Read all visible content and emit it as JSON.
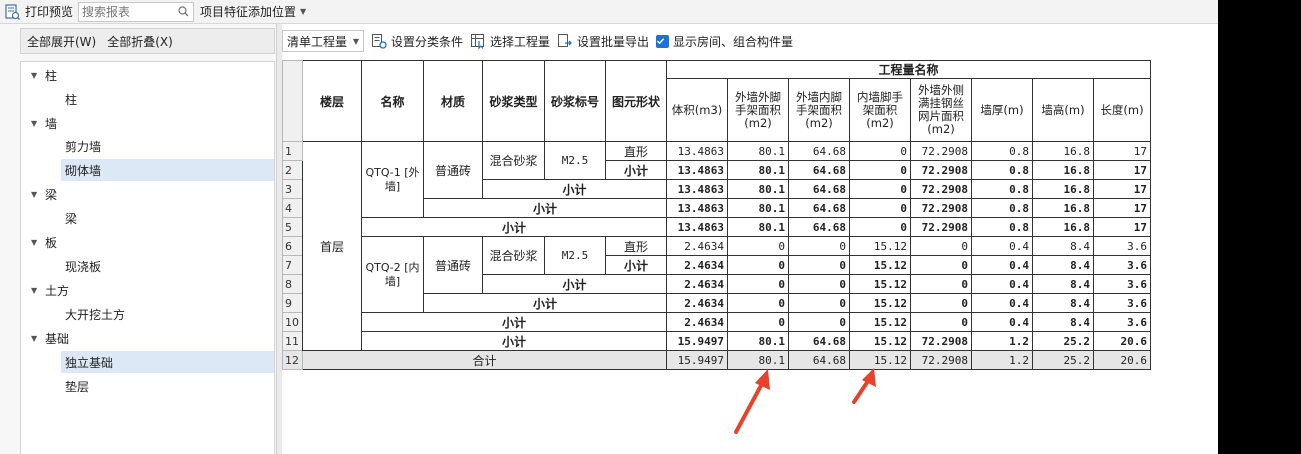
{
  "toolbar": {
    "print_preview": "打印预览",
    "search_placeholder": "搜索报表",
    "feature_position": "项目特征添加位置"
  },
  "left_panel": {
    "expand_all": "全部展开(W)",
    "collapse_all": "全部折叠(X)",
    "tree": [
      {
        "label": "柱",
        "children": [
          "柱"
        ]
      },
      {
        "label": "墙",
        "children": [
          "剪力墙",
          "砌体墙"
        ]
      },
      {
        "label": "梁",
        "children": [
          "梁"
        ]
      },
      {
        "label": "板",
        "children": [
          "现浇板"
        ]
      },
      {
        "label": "土方",
        "children": [
          "大开挖土方"
        ]
      },
      {
        "label": "基础",
        "children": [
          "独立基础",
          "垫层"
        ]
      }
    ],
    "selected": [
      "砌体墙",
      "独立基础"
    ]
  },
  "right_toolbar": {
    "quantity_type": "清单工程量",
    "set_category": "设置分类条件",
    "select_quantity": "选择工程量",
    "batch_export": "设置批量导出",
    "show_room": "显示房间、组合构件量",
    "show_room_checked": true
  },
  "table": {
    "headers": {
      "floor": "楼层",
      "name": "名称",
      "material": "材质",
      "mortar_type": "砂浆类型",
      "mortar_grade": "砂浆标号",
      "shape": "图元形状",
      "quantity_group": "工程量名称",
      "quantities": [
        "体积(m3)",
        "外墙外脚手架面积(m2)",
        "外墙内脚手架面积(m2)",
        "内墙脚手架面积(m2)",
        "外墙外侧满挂钢丝网片面积(m2)",
        "墙厚(m)",
        "墙高(m)",
        "长度(m)"
      ]
    },
    "floor": "首层",
    "groups": [
      {
        "name": "QTQ-1 [外墙]",
        "material": "普通砖",
        "mortar_type": "混合砂浆",
        "mortar_grade": "M2.5",
        "shape": "直形"
      },
      {
        "name": "QTQ-2 [内墙]",
        "material": "普通砖",
        "mortar_type": "混合砂浆",
        "mortar_grade": "M2.5",
        "shape": "直形"
      }
    ],
    "subtotal_label": "小计",
    "total_label": "合计",
    "rows": [
      {
        "n": "1",
        "v": [
          "13.4863",
          "80.1",
          "64.68",
          "0",
          "72.2908",
          "0.8",
          "16.8",
          "17"
        ]
      },
      {
        "n": "2",
        "v": [
          "13.4863",
          "80.1",
          "64.68",
          "0",
          "72.2908",
          "0.8",
          "16.8",
          "17"
        ]
      },
      {
        "n": "3",
        "v": [
          "13.4863",
          "80.1",
          "64.68",
          "0",
          "72.2908",
          "0.8",
          "16.8",
          "17"
        ]
      },
      {
        "n": "4",
        "v": [
          "13.4863",
          "80.1",
          "64.68",
          "0",
          "72.2908",
          "0.8",
          "16.8",
          "17"
        ]
      },
      {
        "n": "5",
        "v": [
          "13.4863",
          "80.1",
          "64.68",
          "0",
          "72.2908",
          "0.8",
          "16.8",
          "17"
        ]
      },
      {
        "n": "6",
        "v": [
          "2.4634",
          "0",
          "0",
          "15.12",
          "0",
          "0.4",
          "8.4",
          "3.6"
        ]
      },
      {
        "n": "7",
        "v": [
          "2.4634",
          "0",
          "0",
          "15.12",
          "0",
          "0.4",
          "8.4",
          "3.6"
        ]
      },
      {
        "n": "8",
        "v": [
          "2.4634",
          "0",
          "0",
          "15.12",
          "0",
          "0.4",
          "8.4",
          "3.6"
        ]
      },
      {
        "n": "9",
        "v": [
          "2.4634",
          "0",
          "0",
          "15.12",
          "0",
          "0.4",
          "8.4",
          "3.6"
        ]
      },
      {
        "n": "10",
        "v": [
          "2.4634",
          "0",
          "0",
          "15.12",
          "0",
          "0.4",
          "8.4",
          "3.6"
        ]
      },
      {
        "n": "11",
        "v": [
          "15.9497",
          "80.1",
          "64.68",
          "15.12",
          "72.2908",
          "1.2",
          "25.2",
          "20.6"
        ]
      },
      {
        "n": "12",
        "v": [
          "15.9497",
          "80.1",
          "64.68",
          "15.12",
          "72.2908",
          "1.2",
          "25.2",
          "20.6"
        ]
      }
    ]
  },
  "colors": {
    "accent": "#1a73d6",
    "selected_row": "#dce8f6",
    "annotation_arrow": "#e8412c"
  }
}
